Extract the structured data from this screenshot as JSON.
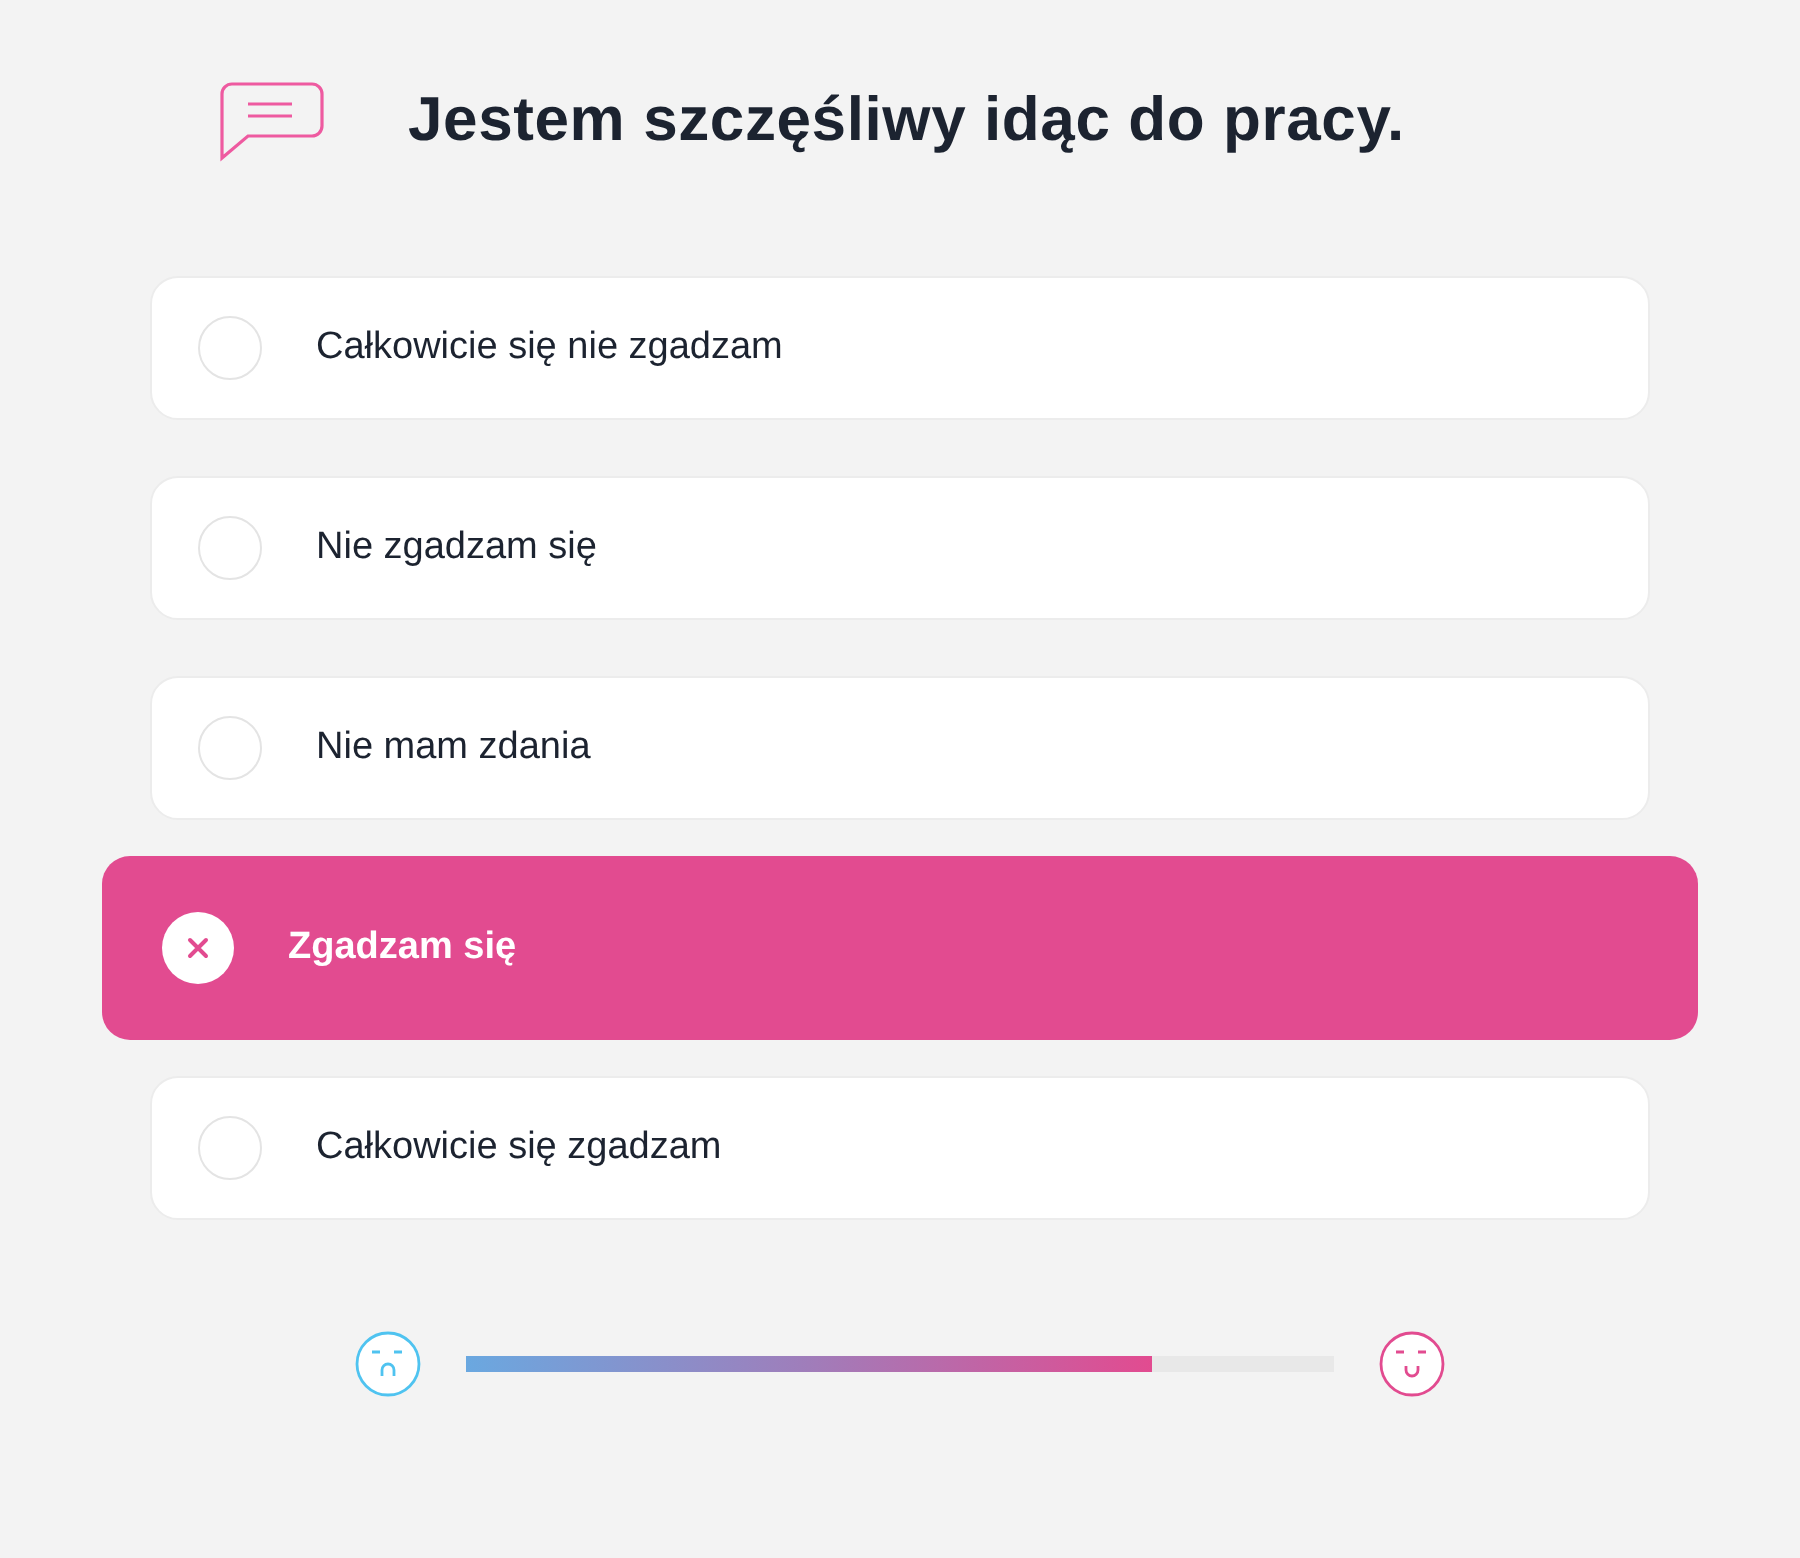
{
  "question": "Jestem szczęśliwy idąc do pracy.",
  "options": [
    {
      "label": "Całkowicie się nie zgadzam",
      "selected": false
    },
    {
      "label": "Nie zgadzam się",
      "selected": false
    },
    {
      "label": "Nie mam zdania",
      "selected": false
    },
    {
      "label": "Zgadzam się",
      "selected": true
    },
    {
      "label": "Całkowicie się zgadzam",
      "selected": false
    }
  ],
  "progress": {
    "level": 0.79
  }
}
